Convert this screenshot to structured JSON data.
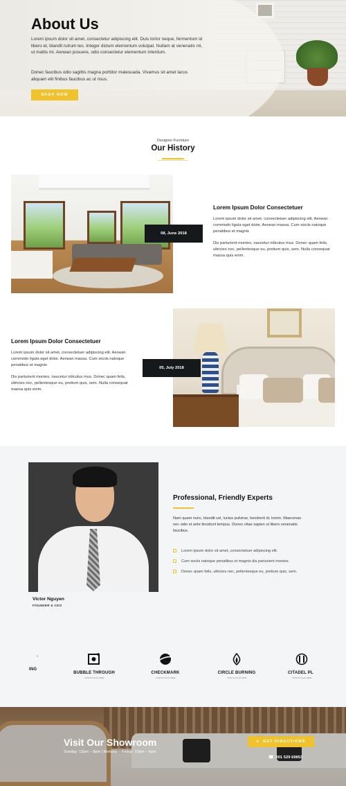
{
  "hero": {
    "title": "About Us",
    "paragraph1": "Lorem ipsum dolor sit amet, consectetur adipiscing elit. Duis tortor neque, fermentum id libero et, blandit rutrum leo. Integer dictum elementum volutpat. Nullam at venenatis mi, ut mattis mi. Aenean posuere, odio consectetur elementum interdum.",
    "paragraph2": "Donec faucibus odio sagittis magna porttitor malesuada. Vivamus sit amet lacus aliquam elit finibus faucibus ac ut risus.",
    "button_label": "SHOP NOW"
  },
  "history": {
    "kicker": "Designer Furniture",
    "title": "Our History",
    "items": [
      {
        "date": "08, June 2018",
        "title": "Lorem Ipsum Dolor Consectetuer",
        "paragraph1": "Lorem ipsum dolor sit amet, consectetuer adipiscing elit. Aenean commodo ligula eget dolor. Aenean massa. Cum sociis natoque penatibus et magnis",
        "paragraph2": "Dis parturient montes, nascetur ridiculus mus. Donec quam felis, ultricies nec, pellentesque eu, pretium quis, sem. Nulla consequat massa quis enim."
      },
      {
        "date": "05, July 2018",
        "title": "Lorem Ipsum Dolor Consectetuer",
        "paragraph1": "Lorem ipsum dolor sit amet, consectetuer adipiscing elit. Aenean commodo ligula eget dolor. Aenean massa. Cum sociis natoque penatibus et magnis",
        "paragraph2": "Dis parturient montes, nascetur ridiculus mus. Donec quam felis, ultricies nec, pellentesque eu, pretium quis, sem. Nulla consequat massa quis enim."
      }
    ]
  },
  "team": {
    "member_name": "Victor Nguyen",
    "member_role": "FOUNDER & CEO",
    "title": "Professional, Friendly Experts",
    "paragraph": "Nam quam nunc, blandit vel, luctus pulvinar, hendrerit id, lorem. Maecenas nec odio et ante tincidunt tempus. Donec vitae sapien ut libero venenatis faucibus.",
    "bullets": [
      "Lorem ipsum dolor sit amet, consectetuer adipiscing elit.",
      "Cum sociis natoque penatibus et magnis dis parturient montes.",
      "Donec quam felis, ultricies nec, pellentesque eu, pretium quis, sem."
    ]
  },
  "logos": [
    {
      "name": "ING",
      "tag": "",
      "icon": "partial-logo-icon"
    },
    {
      "name": "BUBBLE THROUGH",
      "tag": "YOUR SLOGAN HERE",
      "icon": "camera-logo-icon"
    },
    {
      "name": "CHECKMARK",
      "tag": "YOUR SLOGAN HERE",
      "icon": "planet-logo-icon"
    },
    {
      "name": "CIRCLE BURNING",
      "tag": "YOUR SLOGAN HERE",
      "icon": "flame-logo-icon"
    },
    {
      "name": "CITADEL PL",
      "tag": "YOUR SLOGAN HERE",
      "icon": "pillar-logo-icon"
    }
  ],
  "showroom": {
    "title": "Visit Our Showroom",
    "hours": "Sunday: 12pm – 8pm  |  Monday – Friday: 10pm – 6pm",
    "button_label": "GET DIRECTIONS",
    "phone": "001 529 69853"
  },
  "colors": {
    "accent": "#f0c22b",
    "dark": "#15191b",
    "section_bg": "#f4f5f7"
  }
}
